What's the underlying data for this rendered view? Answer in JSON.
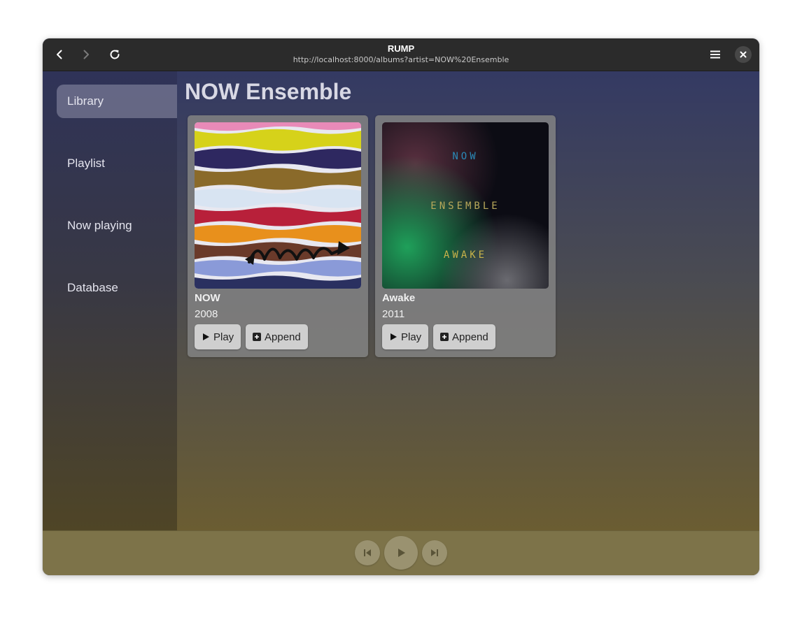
{
  "window": {
    "title": "RUMP",
    "url": "http://localhost:8000/albums?artist=NOW%20Ensemble"
  },
  "icons": {
    "back": "chevron-left-icon",
    "forward": "chevron-right-icon",
    "reload": "reload-icon",
    "menu": "hamburger-icon",
    "close": "close-icon"
  },
  "sidebar": {
    "items": [
      {
        "label": "Library",
        "active": true
      },
      {
        "label": "Playlist",
        "active": false
      },
      {
        "label": "Now playing",
        "active": false
      },
      {
        "label": "Database",
        "active": false
      }
    ]
  },
  "main": {
    "title": "NOW Ensemble",
    "albums": [
      {
        "name": "NOW",
        "year": "2008",
        "play_label": "Play",
        "append_label": "Append"
      },
      {
        "name": "Awake",
        "year": "2011",
        "play_label": "Play",
        "append_label": "Append",
        "cover_text": [
          "NOW",
          "ENSEMBLE",
          "AWAKE"
        ]
      }
    ]
  },
  "player": {
    "controls": [
      "skip-previous-icon",
      "play-icon",
      "skip-next-icon"
    ]
  },
  "colors": {
    "titlebar": "#2b2b2b",
    "player_bar": "#7d7349",
    "card": "#828282"
  }
}
